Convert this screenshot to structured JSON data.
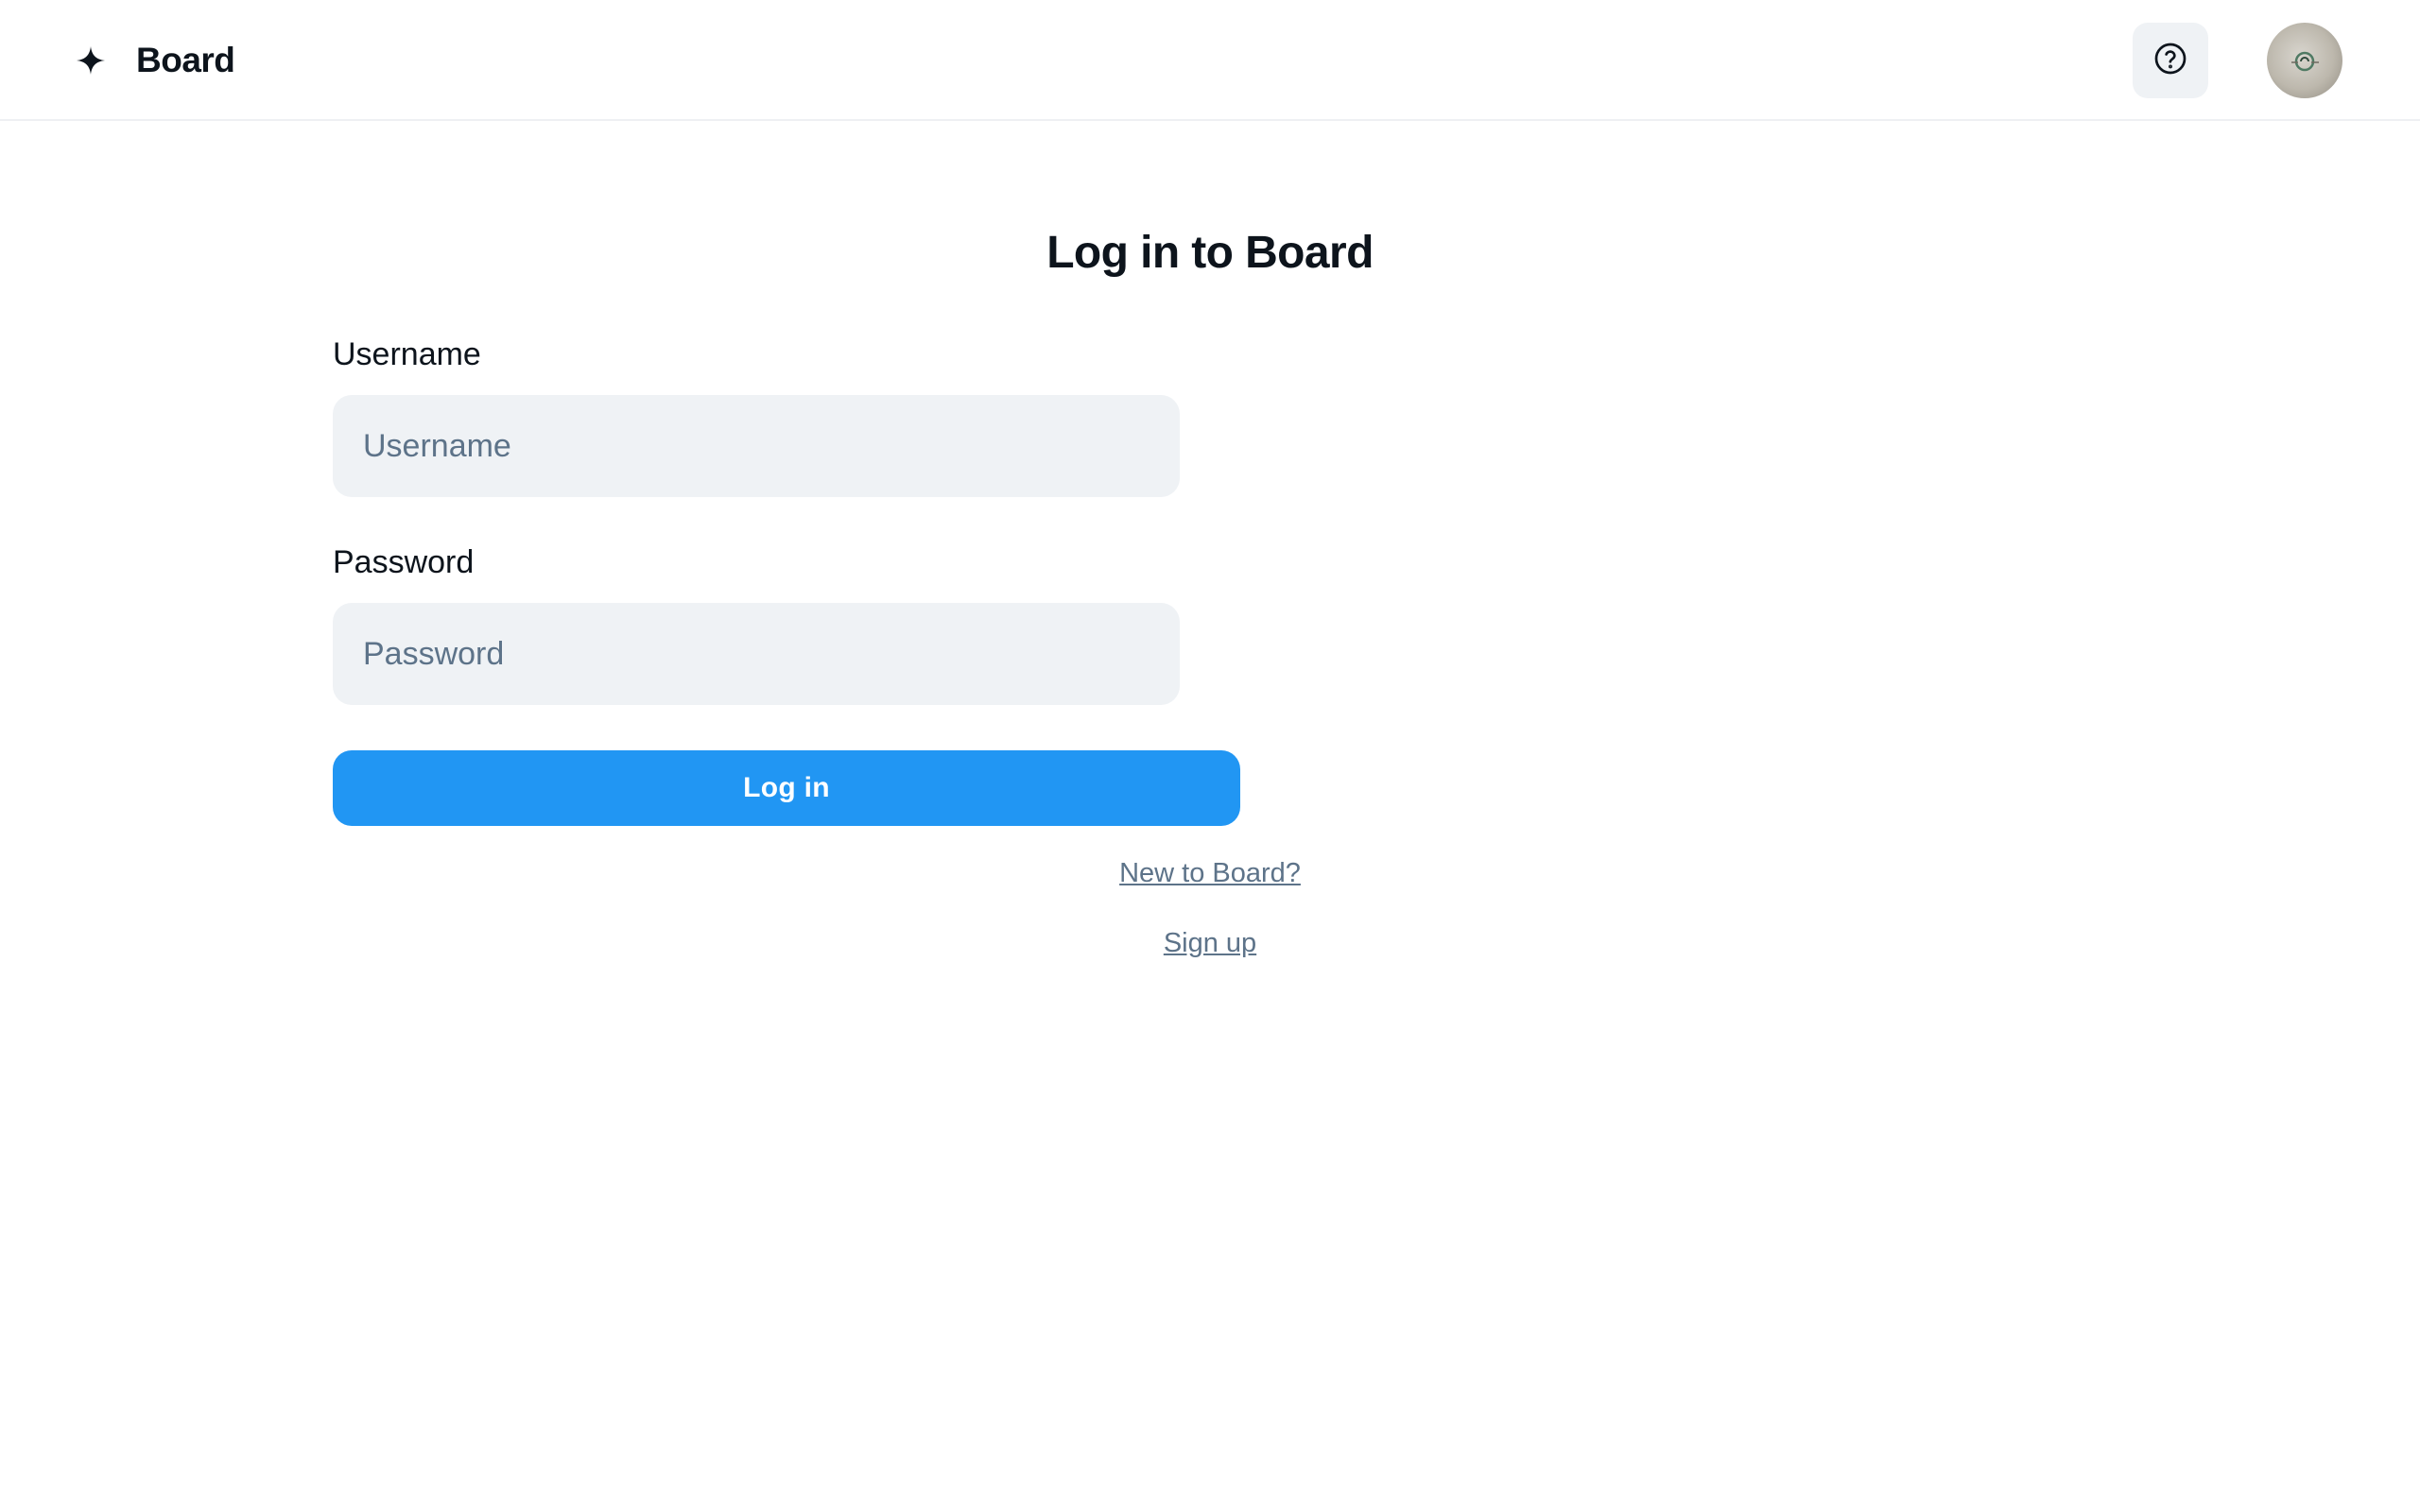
{
  "header": {
    "brand_name": "Board",
    "brand_icon": "sparkle-icon",
    "help_icon": "help-circle-icon",
    "avatar": "user-avatar"
  },
  "login": {
    "title": "Log in to Board",
    "username_label": "Username",
    "username_placeholder": "Username",
    "username_value": "",
    "password_label": "Password",
    "password_placeholder": "Password",
    "password_value": "",
    "submit_label": "Log in",
    "new_user_link": "New to Board?",
    "signup_link": "Sign up"
  },
  "colors": {
    "accent": "#2196f3",
    "input_bg": "#eff2f5",
    "muted_text": "#5d7389",
    "text": "#0d141c"
  }
}
